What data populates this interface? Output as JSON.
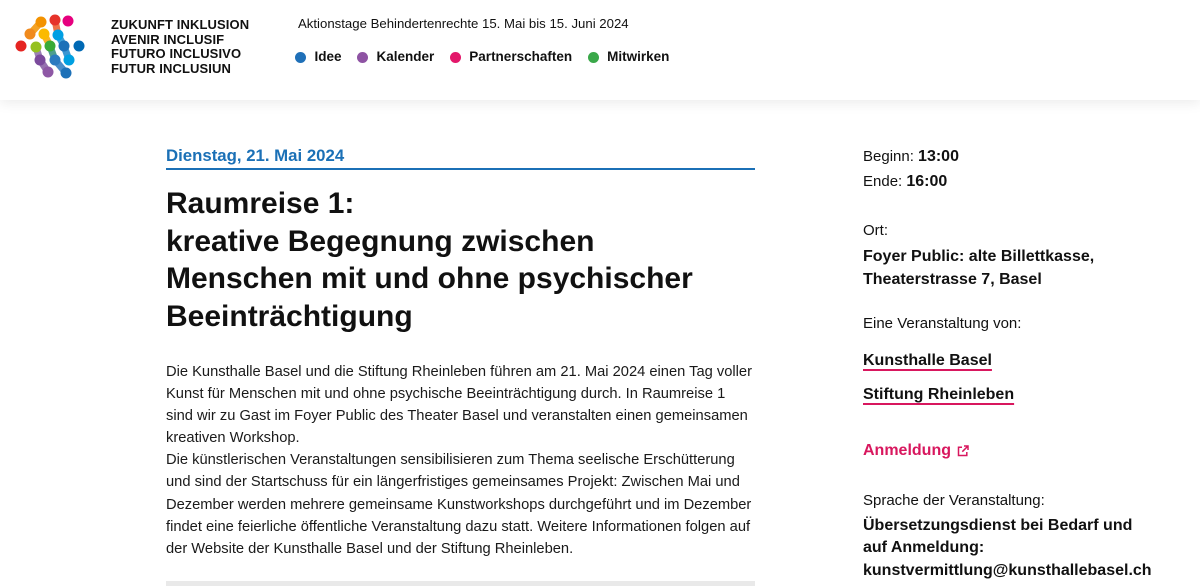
{
  "header": {
    "logo_lines": [
      "ZUKUNFT INKLUSION",
      "AVENIR INCLUSIF",
      "FUTURO INCLUSIVO",
      "FUTUR INCLUSIUN"
    ],
    "logo_icon": "colorful-dot-network-icon",
    "tagline": "Aktionstage Behindertenrechte 15. Mai bis 15. Juni 2024",
    "nav": [
      {
        "label": "Idee",
        "dot_color": "#1f70b8"
      },
      {
        "label": "Kalender",
        "dot_color": "#8e53a3"
      },
      {
        "label": "Partnerschaften",
        "dot_color": "#e3176a"
      },
      {
        "label": "Mitwirken",
        "dot_color": "#3aa849"
      }
    ]
  },
  "event": {
    "date": "Dienstag, 21. Mai 2024",
    "title_lines": [
      "Raumreise 1:",
      "kreative Begegnung zwischen",
      "Menschen mit und ohne psychischer",
      "Beeinträchtigung"
    ],
    "description_lines": [
      "Die Kunsthalle Basel und die Stiftung Rheinleben führen am 21. Mai 2024 einen Tag voller",
      "Kunst für Menschen mit und ohne psychische Beeinträchtigung durch. In Raumreise 1",
      "sind wir zu Gast im Foyer Public des Theater Basel und veranstalten einen gemeinsamen",
      "kreativen Workshop.",
      "Die künstlerischen Veranstaltungen sensibilisieren zum Thema seelische Erschütterung",
      "und sind der Startschuss für ein längerfristiges gemeinsames Projekt: Zwischen Mai und",
      "Dezember werden mehrere gemeinsame Kunstworkshops durchgeführt und im Dezember",
      "findet eine feierliche öffentliche Veranstaltung dazu statt. Weitere Informationen folgen auf",
      "der Website der Kunsthalle Basel und der Stiftung Rheinleben."
    ]
  },
  "details": {
    "begin_label": "Beginn:",
    "begin_time": "13:00",
    "end_label": "Ende:",
    "end_time": "16:00",
    "location_label": "Ort:",
    "location_lines": [
      "Foyer Public: alte Billettkasse,",
      "Theaterstrasse 7, Basel"
    ],
    "organizers_label": "Eine Veranstaltung von:",
    "organizers": [
      "Kunsthalle Basel",
      "Stiftung Rheinleben"
    ],
    "registration_label": "Anmeldung",
    "registration_icon": "external-link-icon",
    "language_label": "Sprache der Veranstaltung:",
    "language_lines": [
      "Übersetzungsdienst bei Bedarf und",
      "auf Anmeldung:",
      "kunstvermittlung@kunsthallebasel.ch"
    ]
  },
  "colors": {
    "accent_blue": "#1b70b6",
    "accent_pink": "#d8175e",
    "text": "#111111"
  }
}
